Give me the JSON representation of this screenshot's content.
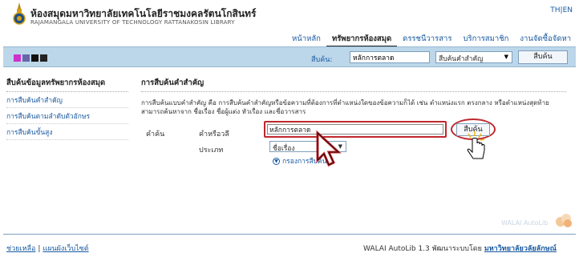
{
  "header": {
    "title_th": "ห้องสมุดมหาวิทยาลัยเทคโนโลยีราชมงคลรัตนโกสินทร์",
    "title_en": "RAJAMANGALA UNIVERSITY OF TECHNOLOGY RATTANAKOSIN LIBRARY",
    "lang_th": "TH",
    "lang_sep": "|",
    "lang_en": "EN",
    "nav": [
      {
        "label": "หน้าหลัก"
      },
      {
        "label": "ทรัพยากรห้องสมุด"
      },
      {
        "label": "ดรรชนีวารสาร"
      },
      {
        "label": "บริการสมาชิก"
      },
      {
        "label": "งานจัดซื้อจัดหา"
      }
    ]
  },
  "searchbar": {
    "swatch_colors": [
      "#cc33cc",
      "#6666aa",
      "#111111",
      "#222222"
    ],
    "label": "สืบค้น:",
    "value": "หลักการตลาด",
    "select_value": "สืบค้นคำสำคัญ",
    "button": "สืบค้น"
  },
  "sidebar": {
    "title": "สืบค้นข้อมูลทรัพยากรห้องสมุด",
    "items": [
      {
        "label": "การสืบค้นคำสำคัญ"
      },
      {
        "label": "การสืบค้นตามลำดับตัวอักษร"
      },
      {
        "label": "การสืบค้นขั้นสูง"
      }
    ]
  },
  "content": {
    "title": "การสืบค้นคำสำคัญ",
    "description": "การสืบค้นแบบคำสำคัญ คือ การสืบค้นคำสำคัญหรือข้อความที่ต้องการที่ตำแหน่งใดของข้อความก็ได้ เช่น ตำแหน่งแรก ตรงกลาง หรือตำแหน่งสุดท้าย สามารถค้นหาจาก ชื่อเรื่อง ชื่อผู้แต่ง หัวเรื่อง และชื่อวารสาร",
    "section_label": "คำค้น",
    "keyword_label": "คำหรือวลี",
    "keyword_value": "หลักการตลาด",
    "type_label": "ประเภท",
    "type_value": "ชื่อเรื่อง",
    "filter_link": "กรองการสืบค้น",
    "search_button": "สืบค้น"
  },
  "watermark": "WALAI AutoLib",
  "footer": {
    "help": "ช่วยเหลือ",
    "sep": "|",
    "sitemap": "แผนผังเว็บไซต์",
    "credit": "WALAI AutoLib 1.3 พัฒนาระบบโดย",
    "credit_link": "มหาวิทยาลัยวลัยลักษณ์"
  }
}
